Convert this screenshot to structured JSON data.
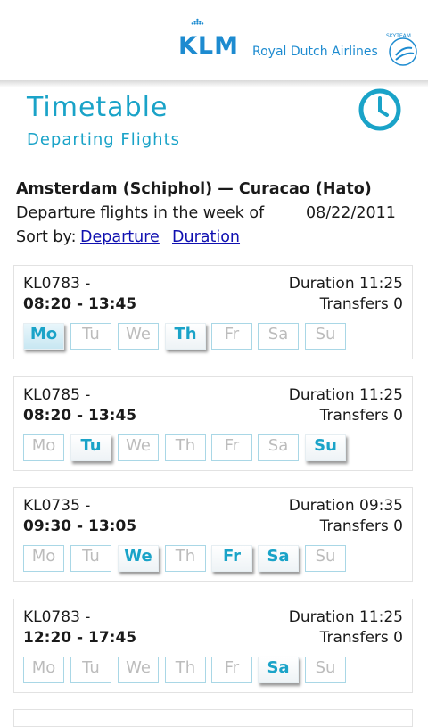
{
  "header": {
    "brand": "KLM",
    "tagline": "Royal Dutch Airlines",
    "skyteam": "SKYTEAM",
    "brand_color": "#1d8bd0"
  },
  "page": {
    "title": "Timetable",
    "subtitle": "Departing Flights",
    "accent_color": "#1aa3c8",
    "clock_icon": "clock-icon"
  },
  "route": {
    "name": "Amsterdam (Schiphol) — Curacao (Hato)",
    "week_label": "Departure flights in the week of",
    "week_date": "08/22/2011",
    "sort_label": "Sort by:",
    "sort_departure": "Departure",
    "sort_duration": "Duration"
  },
  "days": [
    "Mo",
    "Tu",
    "We",
    "Th",
    "Fr",
    "Sa",
    "Su"
  ],
  "flights": [
    {
      "number": "KL0783 -",
      "time": "08:20 - 13:45",
      "duration": "Duration 11:25",
      "transfers": "Transfers 0",
      "active": [
        true,
        false,
        false,
        true,
        false,
        false,
        false
      ]
    },
    {
      "number": "KL0785 -",
      "time": "08:20 - 13:45",
      "duration": "Duration 11:25",
      "transfers": "Transfers 0",
      "active": [
        false,
        true,
        false,
        false,
        false,
        false,
        true
      ]
    },
    {
      "number": "KL0735 -",
      "time": "09:30 - 13:05",
      "duration": "Duration 09:35",
      "transfers": "Transfers 0",
      "active": [
        false,
        false,
        true,
        false,
        true,
        true,
        false
      ]
    },
    {
      "number": "KL0783 -",
      "time": "12:20 - 17:45",
      "duration": "Duration 11:25",
      "transfers": "Transfers 0",
      "active": [
        false,
        false,
        false,
        false,
        false,
        true,
        false
      ]
    }
  ]
}
